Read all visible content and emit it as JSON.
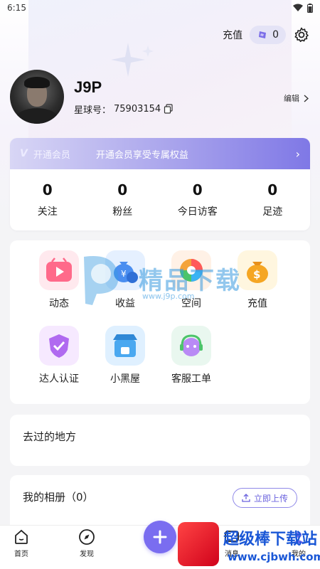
{
  "status": {
    "time": "6:15"
  },
  "header": {
    "recharge_label": "充值",
    "coin_count": "0"
  },
  "profile": {
    "username": "J9P",
    "uid_label": "星球号：",
    "uid": "75903154",
    "edit_label": "编辑"
  },
  "vip": {
    "logo": "V",
    "title": "开通会员",
    "desc": "开通会员享受专属权益",
    "arrow": "›"
  },
  "stats": [
    {
      "value": "0",
      "label": "关注"
    },
    {
      "value": "0",
      "label": "粉丝"
    },
    {
      "value": "0",
      "label": "今日访客"
    },
    {
      "value": "0",
      "label": "足迹"
    }
  ],
  "features": [
    {
      "label": "动态",
      "icon": "video-play-icon",
      "color": "#ff6a8a"
    },
    {
      "label": "收益",
      "icon": "money-bag-icon",
      "color": "#4a8ef0"
    },
    {
      "label": "空间",
      "icon": "camera-aperture-icon",
      "color": "#f4a33a"
    },
    {
      "label": "充值",
      "icon": "coin-bag-icon",
      "color": "#f5a623"
    },
    {
      "label": "达人认证",
      "icon": "shield-badge-icon",
      "color": "#b06af0"
    },
    {
      "label": "小黑屋",
      "icon": "shop-icon",
      "color": "#4aa8f0"
    },
    {
      "label": "客服工单",
      "icon": "headset-bot-icon",
      "color": "#b98af5"
    }
  ],
  "places": {
    "title": "去过的地方"
  },
  "album": {
    "title": "我的相册（0）",
    "upload_label": "立即上传"
  },
  "tabbar": {
    "home": "首页",
    "discover": "发现",
    "messages": "消息",
    "mine": "我的"
  },
  "watermarks": {
    "site1": "精品下载",
    "site1_url": "www.j9p.com",
    "site2": "超级棒下载站",
    "site2_url": "www.cjbwh.com"
  }
}
